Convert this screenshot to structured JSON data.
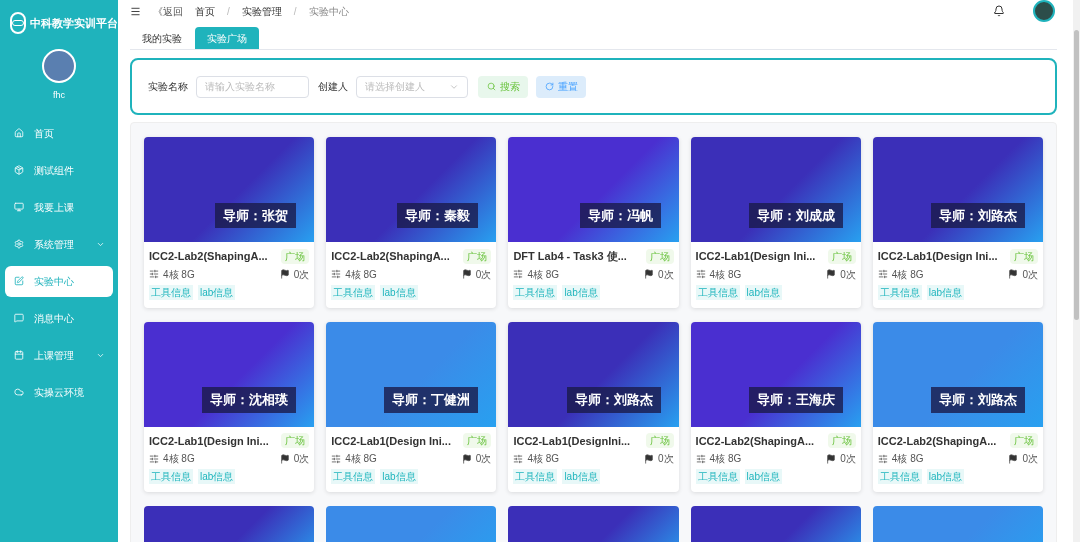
{
  "sidebar": {
    "brand": "中科教学实训平台",
    "user": "fhc",
    "items": [
      {
        "label": "首页",
        "kind": "link",
        "selected": false
      },
      {
        "label": "测试组件",
        "kind": "link",
        "selected": false
      },
      {
        "label": "我要上课",
        "kind": "link",
        "selected": false
      },
      {
        "label": "系统管理",
        "kind": "group",
        "selected": false
      },
      {
        "label": "实验中心",
        "kind": "link",
        "selected": true
      },
      {
        "label": "消息中心",
        "kind": "link",
        "selected": false
      },
      {
        "label": "上课管理",
        "kind": "group",
        "selected": false
      },
      {
        "label": "实操云环境",
        "kind": "link",
        "selected": false
      }
    ]
  },
  "header": {
    "back": "《返回",
    "separator": "/",
    "breadcrumb": [
      "首页",
      "实验管理",
      "实验中心"
    ]
  },
  "tabs": [
    {
      "label": "我的实验",
      "selected": false
    },
    {
      "label": "实验广场",
      "selected": true
    }
  ],
  "search": {
    "name_label": "实验名称",
    "name_placeholder": "请输入实验名称",
    "creator_label": "创建人",
    "creator_placeholder": "请选择创建人",
    "search_button": "搜索",
    "reset_button": "重置"
  },
  "cards": [
    {
      "color": "#3b2fb8",
      "tutor": "导师：张贺",
      "title": "ICC2-Lab2(ShapingA...",
      "tag": "广场",
      "spec": "4核 8G",
      "count": "0次",
      "labels": [
        "工具信息",
        "lab信息"
      ]
    },
    {
      "color": "#3b2fb8",
      "tutor": "导师：秦毅",
      "title": "ICC2-Lab2(ShapingA...",
      "tag": "广场",
      "spec": "4核 8G",
      "count": "0次",
      "labels": [
        "工具信息",
        "lab信息"
      ]
    },
    {
      "color": "#4a2fd0",
      "tutor": "导师：冯帆",
      "title": "DFT Lab4 - Task3 使...",
      "tag": "广场",
      "spec": "4核 8G",
      "count": "0次",
      "labels": [
        "工具信息",
        "lab信息"
      ]
    },
    {
      "color": "#3b2fb8",
      "tutor": "导师：刘成成",
      "title": "ICC2-Lab1(Design Ini...",
      "tag": "广场",
      "spec": "4核 8G",
      "count": "0次",
      "labels": [
        "工具信息",
        "lab信息"
      ]
    },
    {
      "color": "#3b2fb8",
      "tutor": "导师：刘路杰",
      "title": "ICC2-Lab1(Design Ini...",
      "tag": "广场",
      "spec": "4核 8G",
      "count": "0次",
      "labels": [
        "工具信息",
        "lab信息"
      ]
    },
    {
      "color": "#4a2fd0",
      "tutor": "导师：沈相瑛",
      "title": "ICC2-Lab1(Design Ini...",
      "tag": "广场",
      "spec": "4核 8G",
      "count": "0次",
      "labels": [
        "工具信息",
        "lab信息"
      ]
    },
    {
      "color": "#3b8be8",
      "tutor": "导师：丁健洲",
      "title": "ICC2-Lab1(Design Ini...",
      "tag": "广场",
      "spec": "4核 8G",
      "count": "0次",
      "labels": [
        "工具信息",
        "lab信息"
      ]
    },
    {
      "color": "#3b2fb8",
      "tutor": "导师：刘路杰",
      "title": "ICC2-Lab1(DesignIni...",
      "tag": "广场",
      "spec": "4核 8G",
      "count": "0次",
      "labels": [
        "工具信息",
        "lab信息"
      ]
    },
    {
      "color": "#4a2fd0",
      "tutor": "导师：王海庆",
      "title": "ICC2-Lab2(ShapingA...",
      "tag": "广场",
      "spec": "4核 8G",
      "count": "0次",
      "labels": [
        "工具信息",
        "lab信息"
      ]
    },
    {
      "color": "#3b8be8",
      "tutor": "导师：刘路杰",
      "title": "ICC2-Lab2(ShapingA...",
      "tag": "广场",
      "spec": "4核 8G",
      "count": "0次",
      "labels": [
        "工具信息",
        "lab信息"
      ]
    }
  ],
  "partial_cards": [
    {
      "color": "#3b2fb8"
    },
    {
      "color": "#3b8be8"
    },
    {
      "color": "#3b2fb8"
    },
    {
      "color": "#3b2fb8"
    },
    {
      "color": "#3b8be8"
    }
  ]
}
